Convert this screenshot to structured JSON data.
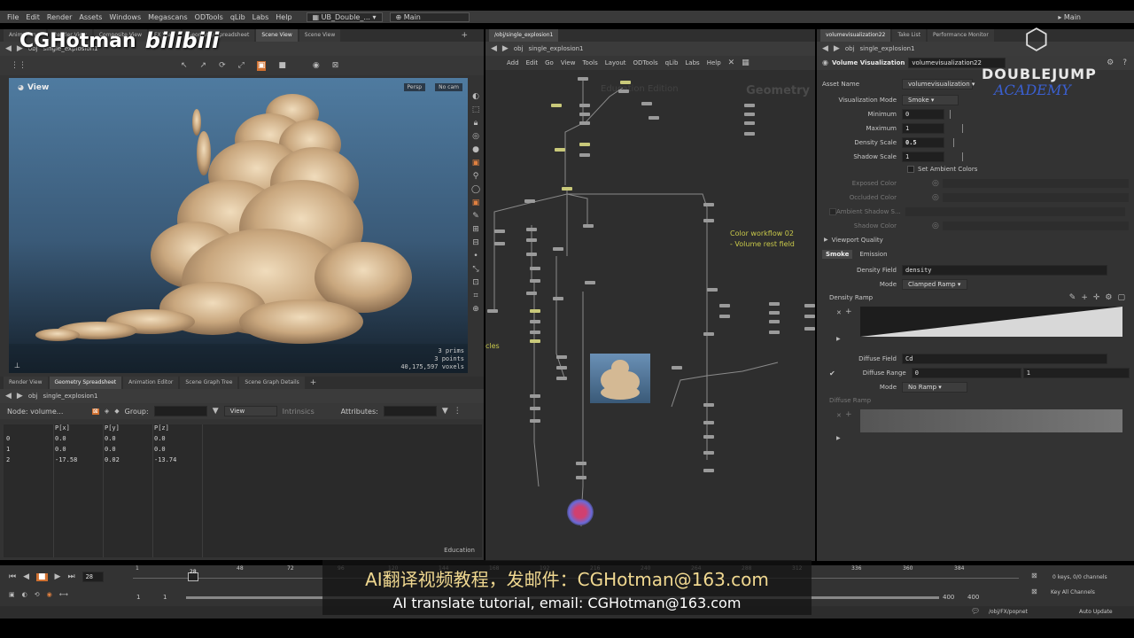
{
  "menubar": {
    "items": [
      "File",
      "Edit",
      "Render",
      "Assets",
      "Windows",
      "Megascans",
      "ODTools",
      "qLib",
      "Labs",
      "Help"
    ],
    "desktop": "UB_Double_...",
    "workspace": "Main",
    "right_workspace": "Main"
  },
  "watermarks": {
    "cghotman": "CGHotman",
    "bilibili": "bilibili",
    "brand_line1": "DOUBLEJUMP",
    "brand_line2": "ACADEMY"
  },
  "viewer": {
    "tabs": [
      "Animation...",
      "Render View",
      "Composite View",
      "FX View",
      "Geometry Spreadsheet",
      "Scene View",
      "Scene View"
    ],
    "path_root": "obj",
    "path_node": "single_explosion1",
    "label": "View",
    "persp": "Persp",
    "cam": "No cam",
    "stats": [
      "3  prims",
      "3  points",
      "40,175,597  voxels"
    ]
  },
  "network": {
    "path": "/obj/single_explosion1",
    "path_root": "obj",
    "path_node": "single_explosion1",
    "menu": [
      "Add",
      "Edit",
      "Go",
      "View",
      "Tools",
      "Layout",
      "ODTools",
      "qLib",
      "Labs",
      "Help"
    ],
    "bg_label": "Geometry",
    "bg_label2": "Education Edition",
    "note_line1": "Color workflow 02",
    "note_line2": "- Volume rest field",
    "left_note": "cles"
  },
  "params": {
    "tabs": [
      "volumevisualization22",
      "Take List",
      "Performance Monitor"
    ],
    "path_root": "obj",
    "path_node": "single_explosion1",
    "node_type": "Volume Visualization",
    "node_name": "volumevisualization22",
    "asset_name_label": "Asset Name",
    "asset_name_value": "volumevisualization",
    "rows": [
      {
        "label": "Visualization Mode",
        "value": "Smoke"
      },
      {
        "label": "Minimum",
        "value": "0"
      },
      {
        "label": "Maximum",
        "value": "1"
      },
      {
        "label": "Density Scale",
        "value": "0.5"
      },
      {
        "label": "Shadow Scale",
        "value": "1"
      }
    ],
    "set_ambient": "Set Ambient Colors",
    "dim_rows": [
      "Exposed Color",
      "Occluded Color",
      "Ambient Shadow S...",
      "Shadow Color"
    ],
    "viewport_quality": "Viewport Quality",
    "sub_tabs": [
      "Smoke",
      "Emission"
    ],
    "density_field_label": "Density Field",
    "density_field_value": "density",
    "mode_label": "Mode",
    "mode_value": "Clamped Ramp",
    "density_ramp_label": "Density Ramp",
    "diffuse_field_label": "Diffuse Field",
    "diffuse_field_value": "Cd",
    "diffuse_range_label": "Diffuse Range",
    "diffuse_range_min": "0",
    "diffuse_range_max": "1",
    "mode2_label": "Mode",
    "mode2_value": "No Ramp",
    "diffuse_ramp_label": "Diffuse Ramp"
  },
  "spreadsheet": {
    "tabs": [
      "Render View",
      "Geometry Spreadsheet",
      "Animation Editor",
      "Scene Graph Tree",
      "Scene Graph Details"
    ],
    "path_root": "obj",
    "path_node": "single_explosion1",
    "node_label": "Node: volume...",
    "group_label": "Group:",
    "view_label": "View",
    "intrinsics": "Intrinsics",
    "attributes_label": "Attributes:",
    "columns": [
      "",
      "P[x]",
      "P[y]",
      "P[z]"
    ],
    "rows": [
      [
        "0",
        "0.0",
        "0.0",
        "0.0"
      ],
      [
        "1",
        "0.0",
        "0.0",
        "0.0"
      ],
      [
        "2",
        "-17.58",
        "0.02",
        "-13.74"
      ]
    ],
    "footer": "Education"
  },
  "timeline": {
    "current_frame": "28",
    "ticks": [
      "1",
      "28",
      "48",
      "72",
      "96",
      "120",
      "144",
      "168",
      "192",
      "216",
      "240",
      "264",
      "288",
      "312",
      "336",
      "360",
      "384"
    ],
    "start": "1",
    "start2": "1",
    "end": "400",
    "end2": "400",
    "keys": "0 keys, 0/0 channels",
    "key_all": "Key All Channels",
    "status_path": "/obj/FX/popnet",
    "auto_update": "Auto Update"
  },
  "subtitles": {
    "zh": "AI翻译视频教程，发邮件：CGHotman@163.com",
    "en": "AI translate tutorial, email: CGHotman@163.com"
  }
}
